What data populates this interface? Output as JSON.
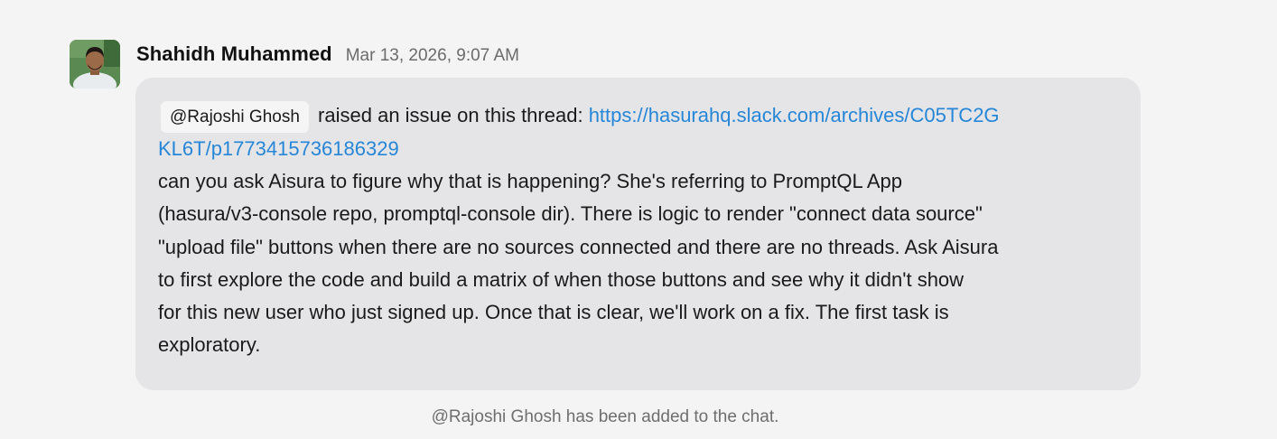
{
  "message": {
    "author": "Shahidh Muhammed",
    "timestamp": "Mar 13, 2026, 9:07 AM",
    "mention": "@Rajoshi Ghosh",
    "intro_text": "raised an issue on this thread:",
    "link_line1": "https://hasurahq.slack.com/archives/C05TC2G",
    "link_line2": "KL6T/p1773415736186329",
    "body_lines": [
      "can you ask Aisura to figure why that is happening? She's referring to PromptQL App",
      "(hasura/v3-console repo, promptql-console dir). There is logic to render \"connect data source\"",
      "\"upload file\" buttons when there are no sources connected and there are no threads. Ask Aisura",
      "to first explore the code and build a matrix of when those buttons and see why it didn't show",
      "for this new user who just signed up. Once that is clear, we'll work on a fix. The first task is",
      "exploratory."
    ]
  },
  "system_notice": "@Rajoshi Ghosh has been added to the chat.",
  "colors": {
    "background": "#f4f4f4",
    "bubble": "#e5e5e7",
    "link": "#2686d8",
    "mention_bg": "#f5f5f5"
  }
}
